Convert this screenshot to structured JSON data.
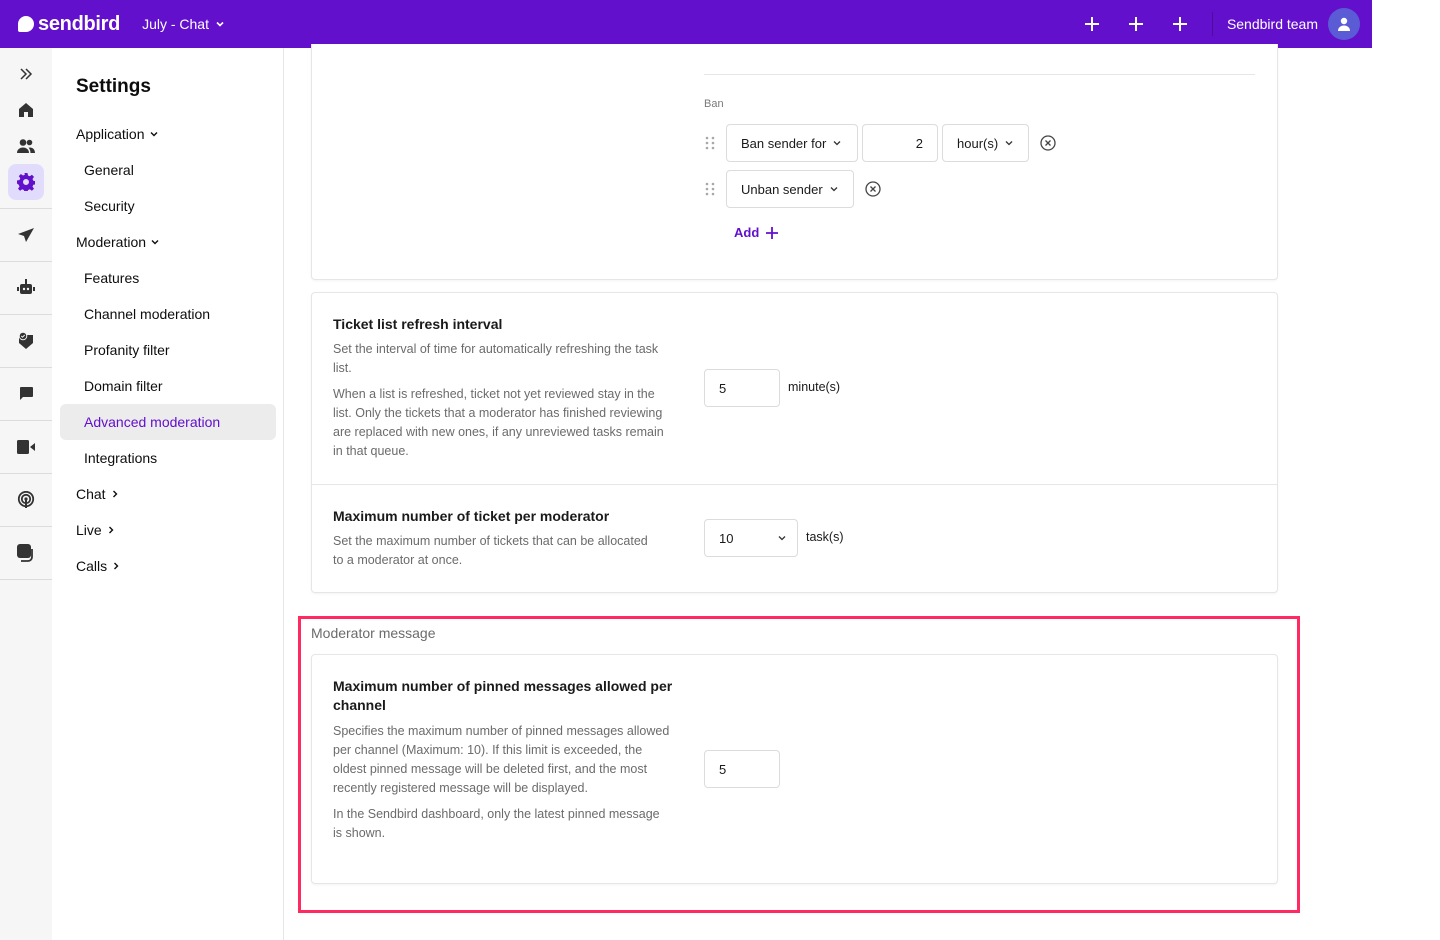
{
  "topbar": {
    "brand": "sendbird",
    "app_name": "July - Chat",
    "team_name": "Sendbird team",
    "icons": [
      "plus-icon",
      "plus-icon",
      "plus-icon",
      "user-icon"
    ],
    "brand_color": "#6210cc"
  },
  "rail": {
    "items": [
      {
        "icon": "double-chevron-right-icon"
      },
      {
        "icon": "home-icon"
      },
      {
        "icon": "users-icon"
      },
      {
        "icon": "gear-icon",
        "active": true
      },
      {
        "icon": "send-icon"
      },
      {
        "icon": "bot-icon"
      },
      {
        "icon": "shield-check-icon"
      },
      {
        "icon": "chat-bubble-icon"
      },
      {
        "icon": "video-icon"
      },
      {
        "icon": "broadcast-icon"
      },
      {
        "icon": "notification-icon"
      }
    ]
  },
  "nav": {
    "title": "Settings",
    "items": [
      {
        "label": "Application",
        "type": "group",
        "chevron": "down"
      },
      {
        "label": "General",
        "type": "sub"
      },
      {
        "label": "Security",
        "type": "sub"
      },
      {
        "label": "Moderation",
        "type": "group",
        "chevron": "down"
      },
      {
        "label": "Features",
        "type": "sub"
      },
      {
        "label": "Channel moderation",
        "type": "sub"
      },
      {
        "label": "Profanity filter",
        "type": "sub"
      },
      {
        "label": "Domain filter",
        "type": "sub"
      },
      {
        "label": "Advanced moderation",
        "type": "sub",
        "active": true
      },
      {
        "label": "Integrations",
        "type": "sub"
      },
      {
        "label": "Chat",
        "type": "group",
        "chevron": "right"
      },
      {
        "label": "Live",
        "type": "group",
        "chevron": "right"
      },
      {
        "label": "Calls",
        "type": "group",
        "chevron": "right"
      }
    ]
  },
  "ban": {
    "label": "Ban",
    "rows": [
      {
        "action": "Ban sender for",
        "amount": "2",
        "unit": "hour(s)"
      },
      {
        "action": "Unban sender"
      }
    ],
    "add_label": "Add"
  },
  "settings": {
    "refresh": {
      "title": "Ticket list refresh interval",
      "desc1": "Set the interval of time for automatically refreshing the task list.",
      "desc2": "When a list is refreshed, ticket not yet reviewed stay in the list. Only the tickets that a moderator has finished reviewing are replaced with new ones, if any unreviewed tasks remain in that queue.",
      "value": "5",
      "unit": "minute(s)"
    },
    "max_ticket": {
      "title": "Maximum number of ticket per moderator",
      "desc": "Set the maximum number of tickets that can be allocated to a moderator at once.",
      "value": "10",
      "unit": "task(s)"
    }
  },
  "moderator_message": {
    "section_label": "Moderator message",
    "pinned": {
      "title": "Maximum number of pinned messages allowed per channel",
      "desc1": "Specifies the maximum number of pinned messages allowed per channel (Maximum: 10). If this limit is exceeded, the oldest pinned message will be deleted first, and the most recently registered message will be displayed.",
      "desc2": "In the Sendbird dashboard, only the latest pinned message is shown.",
      "value": "5"
    },
    "highlight_color": "#ff2a62"
  }
}
